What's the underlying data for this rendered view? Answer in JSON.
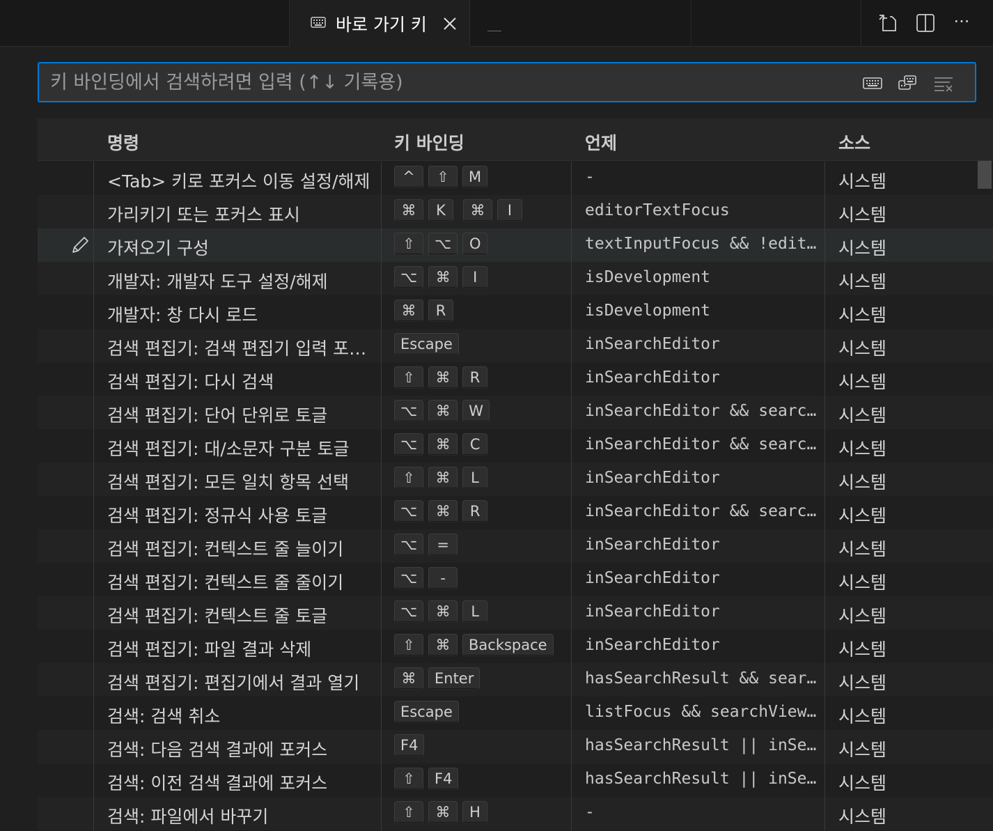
{
  "tab": {
    "label": "바로 가기 키",
    "icon": "keyboard-icon",
    "close_icon": "close-icon"
  },
  "toolbar": {
    "actions": [
      "open-json-icon",
      "split-editor-icon",
      "more-actions-icon"
    ],
    "more_label": "···"
  },
  "search": {
    "placeholder": "키 바인딩에서 검색하려면 입력 (↑↓ 기록용)",
    "value": "",
    "icons": [
      "record-keys-icon",
      "sort-by-precedence-icon",
      "clear-filter-icon"
    ]
  },
  "table": {
    "headers": {
      "command": "명령",
      "keybinding": "키 바인딩",
      "when": "언제",
      "source": "소스"
    },
    "rows": [
      {
        "command": "<Tab> 키로 포커스 이동 설정/해제",
        "chords": [
          [
            "^",
            "⇧",
            "M"
          ]
        ],
        "when": "-",
        "source": "시스템"
      },
      {
        "command": "가리키기 또는 포커스 표시",
        "chords": [
          [
            "⌘",
            "K"
          ],
          [
            "⌘",
            "I"
          ]
        ],
        "when": "editorTextFocus",
        "source": "시스템"
      },
      {
        "command": "가져오기 구성",
        "chords": [
          [
            "⇧",
            "⌥",
            "O"
          ]
        ],
        "when": "textInputFocus && !edit…",
        "source": "시스템",
        "focused": true
      },
      {
        "command": "개발자: 개발자 도구 설정/해제",
        "chords": [
          [
            "⌥",
            "⌘",
            "I"
          ]
        ],
        "when": "isDevelopment",
        "source": "시스템"
      },
      {
        "command": "개발자: 창 다시 로드",
        "chords": [
          [
            "⌘",
            "R"
          ]
        ],
        "when": "isDevelopment",
        "source": "시스템"
      },
      {
        "command": "검색 편집기: 검색 편집기 입력 포…",
        "chords": [
          [
            "Escape"
          ]
        ],
        "when": "inSearchEditor",
        "source": "시스템"
      },
      {
        "command": "검색 편집기: 다시 검색",
        "chords": [
          [
            "⇧",
            "⌘",
            "R"
          ]
        ],
        "when": "inSearchEditor",
        "source": "시스템"
      },
      {
        "command": "검색 편집기: 단어 단위로 토글",
        "chords": [
          [
            "⌥",
            "⌘",
            "W"
          ]
        ],
        "when": "inSearchEditor && searc…",
        "source": "시스템"
      },
      {
        "command": "검색 편집기: 대/소문자 구분 토글",
        "chords": [
          [
            "⌥",
            "⌘",
            "C"
          ]
        ],
        "when": "inSearchEditor && searc…",
        "source": "시스템"
      },
      {
        "command": "검색 편집기: 모든 일치 항목 선택",
        "chords": [
          [
            "⇧",
            "⌘",
            "L"
          ]
        ],
        "when": "inSearchEditor",
        "source": "시스템"
      },
      {
        "command": "검색 편집기: 정규식 사용 토글",
        "chords": [
          [
            "⌥",
            "⌘",
            "R"
          ]
        ],
        "when": "inSearchEditor && searc…",
        "source": "시스템"
      },
      {
        "command": "검색 편집기: 컨텍스트 줄 늘이기",
        "chords": [
          [
            "⌥",
            "="
          ]
        ],
        "when": "inSearchEditor",
        "source": "시스템"
      },
      {
        "command": "검색 편집기: 컨텍스트 줄 줄이기",
        "chords": [
          [
            "⌥",
            "-"
          ]
        ],
        "when": "inSearchEditor",
        "source": "시스템"
      },
      {
        "command": "검색 편집기: 컨텍스트 줄 토글",
        "chords": [
          [
            "⌥",
            "⌘",
            "L"
          ]
        ],
        "when": "inSearchEditor",
        "source": "시스템"
      },
      {
        "command": "검색 편집기: 파일 결과 삭제",
        "chords": [
          [
            "⇧",
            "⌘",
            "Backspace"
          ]
        ],
        "when": "inSearchEditor",
        "source": "시스템"
      },
      {
        "command": "검색 편집기: 편집기에서 결과 열기",
        "chords": [
          [
            "⌘",
            "Enter"
          ]
        ],
        "when": "hasSearchResult && sear…",
        "source": "시스템"
      },
      {
        "command": "검색: 검색 취소",
        "chords": [
          [
            "Escape"
          ]
        ],
        "when": "listFocus && searchView…",
        "source": "시스템"
      },
      {
        "command": "검색: 다음 검색 결과에 포커스",
        "chords": [
          [
            "F4"
          ]
        ],
        "when": "hasSearchResult || inSe…",
        "source": "시스템"
      },
      {
        "command": "검색: 이전 검색 결과에 포커스",
        "chords": [
          [
            "⇧",
            "F4"
          ]
        ],
        "when": "hasSearchResult || inSe…",
        "source": "시스템"
      },
      {
        "command": "검색: 파일에서 바꾸기",
        "chords": [
          [
            "⇧",
            "⌘",
            "H"
          ]
        ],
        "when": "-",
        "source": "시스템"
      }
    ]
  },
  "colors": {
    "accent": "#0078d4",
    "background": "#1f1f1f",
    "row_alt": "#232323",
    "focused_row": "#2a2d2e"
  }
}
